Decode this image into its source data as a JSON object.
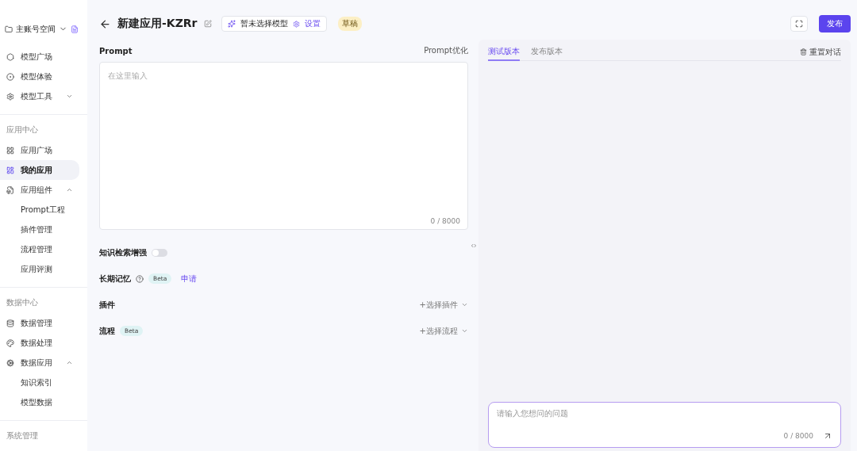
{
  "sidebar": {
    "account": {
      "label": "主账号空间"
    },
    "sections": [
      {
        "items": [
          {
            "label": "模型广场",
            "selected": false
          },
          {
            "label": "模型体验",
            "selected": false
          },
          {
            "label": "模型工具",
            "selected": false,
            "expanded": false
          }
        ]
      },
      {
        "title": "应用中心",
        "items": [
          {
            "label": "应用广场",
            "selected": false
          },
          {
            "label": "我的应用",
            "selected": true
          },
          {
            "label": "应用组件",
            "selected": false,
            "expanded": true,
            "children": [
              {
                "label": "Prompt工程",
                "selected": false
              },
              {
                "label": "插件管理",
                "selected": false
              },
              {
                "label": "流程管理",
                "selected": false
              },
              {
                "label": "应用评测",
                "selected": false
              }
            ]
          }
        ]
      },
      {
        "title": "数据中心",
        "items": [
          {
            "label": "数据管理",
            "selected": false
          },
          {
            "label": "数据处理",
            "selected": false
          },
          {
            "label": "数据应用",
            "selected": false,
            "expanded": true,
            "children": [
              {
                "label": "知识索引",
                "selected": false
              },
              {
                "label": "模型数据",
                "selected": false
              }
            ]
          }
        ]
      },
      {
        "title": "系统管理"
      }
    ]
  },
  "header": {
    "title": "新建应用-KZRr",
    "model": "暂未选择模型",
    "settings": "设置",
    "status": "草稿",
    "publish": "发布"
  },
  "prompt": {
    "label": "Prompt",
    "optimize": "Prompt优化",
    "placeholder": "在这里输入",
    "counter": "0 / 8000"
  },
  "options": [
    {
      "kind": "toggle",
      "label": "知识检索增强",
      "on": false
    },
    {
      "kind": "apply",
      "label": "长期记忆",
      "badge": "Beta",
      "link": "申请"
    },
    {
      "kind": "select",
      "label": "插件",
      "action": "+选择插件"
    },
    {
      "kind": "select",
      "label": "流程",
      "badge": "Beta",
      "action": "+选择流程"
    }
  ],
  "preview": {
    "tabs": [
      {
        "label": "测试版本",
        "selected": true
      },
      {
        "label": "发布版本",
        "selected": false
      }
    ],
    "reset": "重置对话",
    "input": {
      "placeholder": "请输入您想问的问题",
      "counter": "0 / 8000"
    }
  }
}
